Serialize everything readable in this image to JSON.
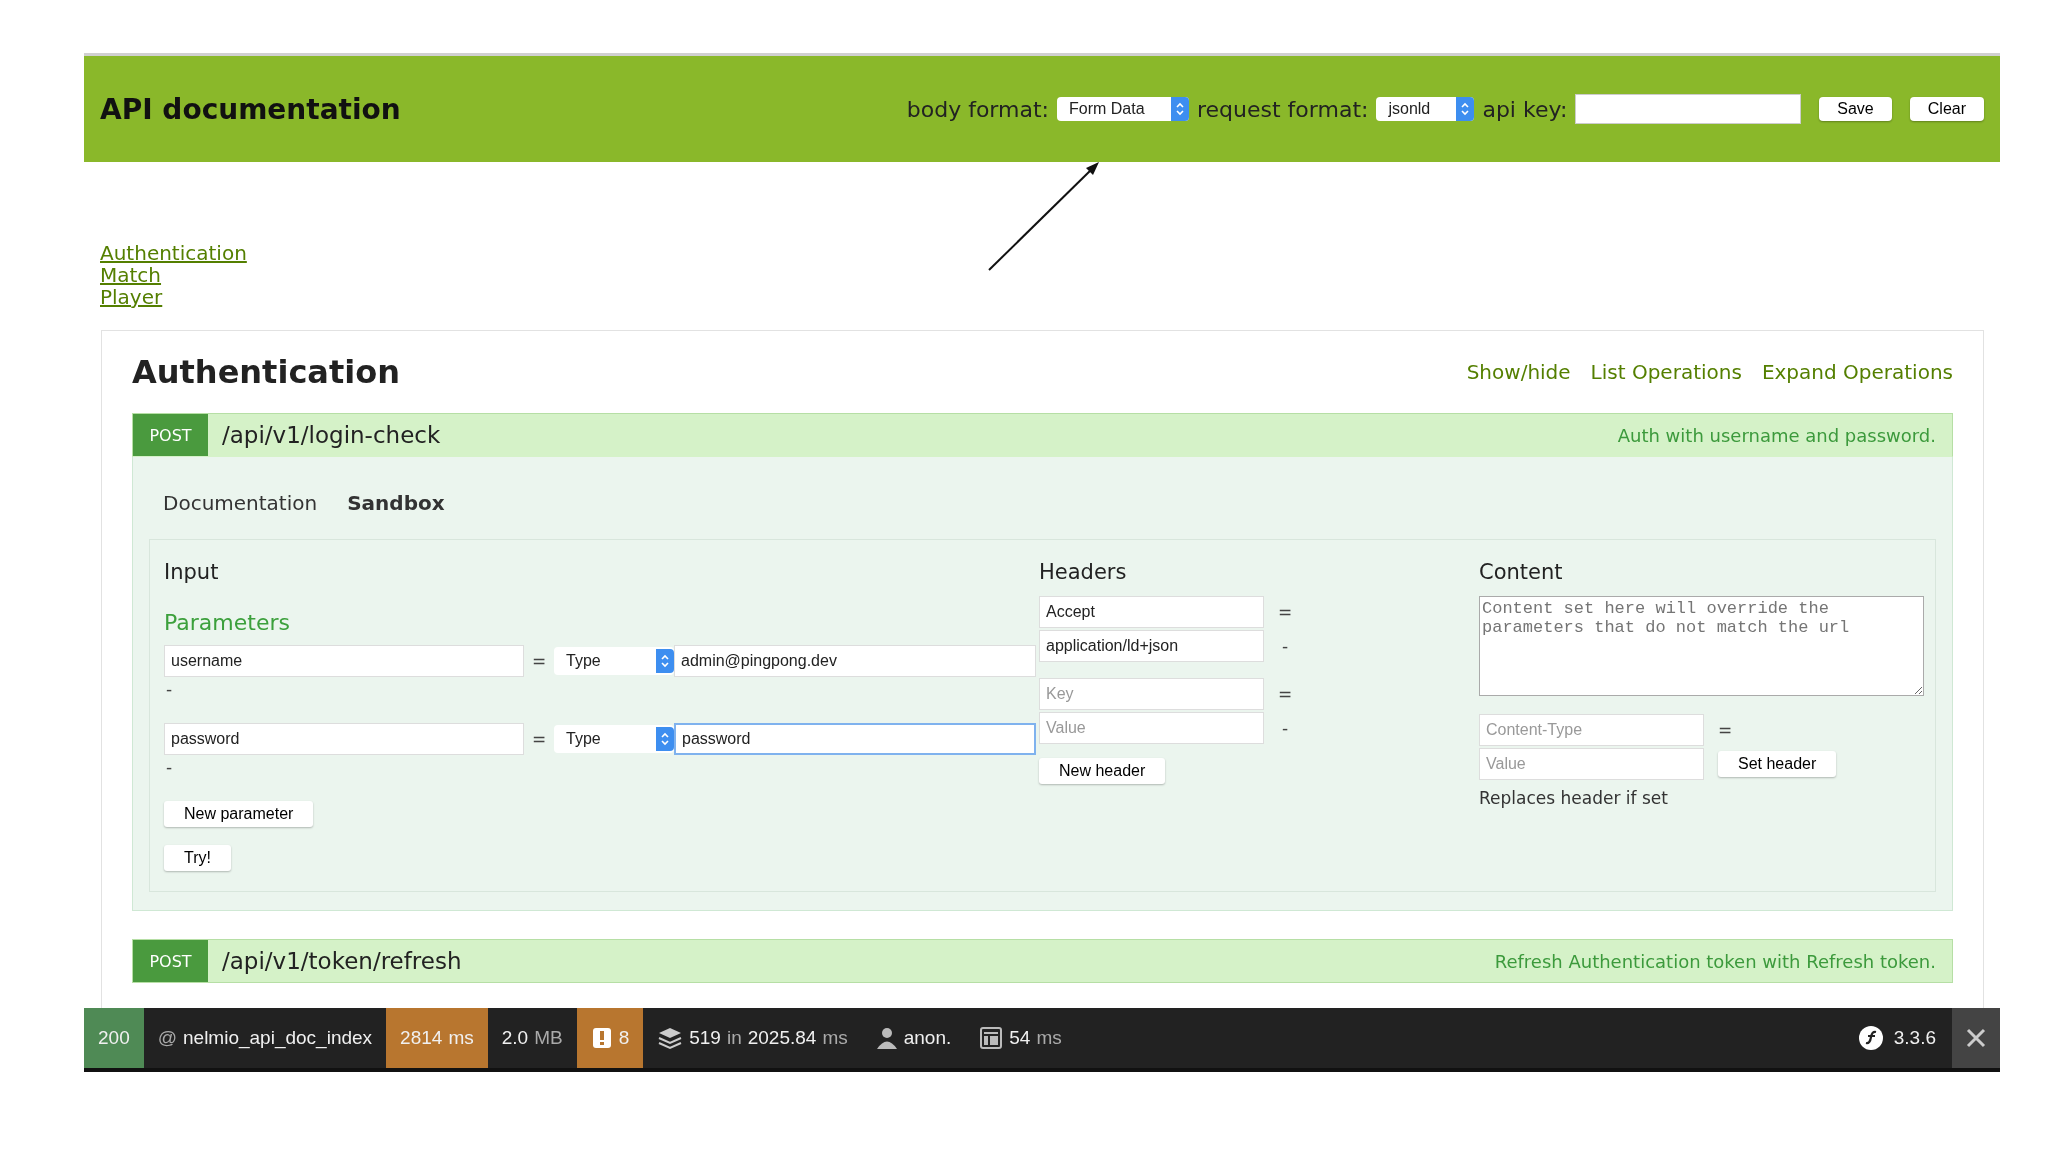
{
  "header": {
    "title": "API documentation",
    "body_format": {
      "label": "body format:",
      "value": "Form Data"
    },
    "request_format": {
      "label": "request format:",
      "value": "jsonld"
    },
    "api_key": {
      "label": "api key:"
    },
    "buttons": [
      "Save",
      "Clear"
    ]
  },
  "nav_links": [
    "Authentication",
    "Match",
    "Player"
  ],
  "section": {
    "title": "Authentication",
    "actions": [
      "Show/hide",
      "List Operations",
      "Expand Operations"
    ],
    "operations": [
      {
        "method": "POST",
        "path": "/api/v1/login-check",
        "description": "Auth with username and password.",
        "expanded": true,
        "tabs": [
          {
            "label": "Documentation",
            "selected": false
          },
          {
            "label": "Sandbox",
            "selected": true
          }
        ],
        "sandbox": {
          "input_title": "Input",
          "parameters_title": "Parameters",
          "parameters": [
            {
              "name": "username",
              "equals": "=",
              "type": "Type",
              "value": "admin@pingpong.dev",
              "separator": "-",
              "focused": false
            },
            {
              "name": "password",
              "equals": "=",
              "type": "Type",
              "value": "password",
              "separator": "-",
              "focused": true
            }
          ],
          "new_parameter": "New parameter",
          "try": "Try!",
          "headers_title": "Headers",
          "headers": [
            {
              "key": "Accept",
              "equals": "=",
              "value": "application/ld+json",
              "separator": "-"
            }
          ],
          "new_header_key_placeholder": "Key",
          "new_header_equals": "=",
          "new_header_value_placeholder": "Value",
          "new_header_separator": "-",
          "new_header": "New header",
          "content_title": "Content",
          "content_placeholder": "Content set here will override the parameters that do not match the url",
          "content_type_placeholder": "Content-Type",
          "content_type_equals": "=",
          "content_value_placeholder": "Value",
          "set_header": "Set header",
          "hint": "Replaces header if set"
        }
      },
      {
        "method": "POST",
        "path": "/api/v1/token/refresh",
        "description": "Refresh Authentication token with Refresh token.",
        "expanded": false
      }
    ]
  },
  "debug_toolbar": {
    "items": [
      {
        "kind": "status",
        "color": "#4f8a55",
        "parts": [
          {
            "text": "200",
            "muted": false
          }
        ]
      },
      {
        "kind": "route",
        "parts": [
          {
            "text": "@",
            "muted": true
          },
          {
            "text": "nelmio_api_doc_index",
            "muted": false
          }
        ]
      },
      {
        "kind": "time",
        "color": "#b8762f",
        "parts": [
          {
            "text": "2814",
            "muted": false
          },
          {
            "text": "ms",
            "muted": false
          }
        ]
      },
      {
        "kind": "memory",
        "parts": [
          {
            "text": "2.0",
            "muted": false
          },
          {
            "text": "MB",
            "muted": true
          }
        ]
      },
      {
        "kind": "warnings",
        "color": "#b8762f",
        "parts": [
          {
            "text": "8",
            "muted": false
          }
        ]
      },
      {
        "kind": "db",
        "parts": [
          {
            "text": "519",
            "muted": false
          },
          {
            "text": "in",
            "muted": true
          },
          {
            "text": "2025.84",
            "muted": false
          },
          {
            "text": "ms",
            "muted": true
          }
        ]
      },
      {
        "kind": "user",
        "parts": [
          {
            "text": "anon.",
            "muted": false
          }
        ]
      },
      {
        "kind": "template",
        "parts": [
          {
            "text": "54",
            "muted": false
          },
          {
            "text": "ms",
            "muted": true
          }
        ]
      }
    ],
    "version": "3.3.6"
  }
}
